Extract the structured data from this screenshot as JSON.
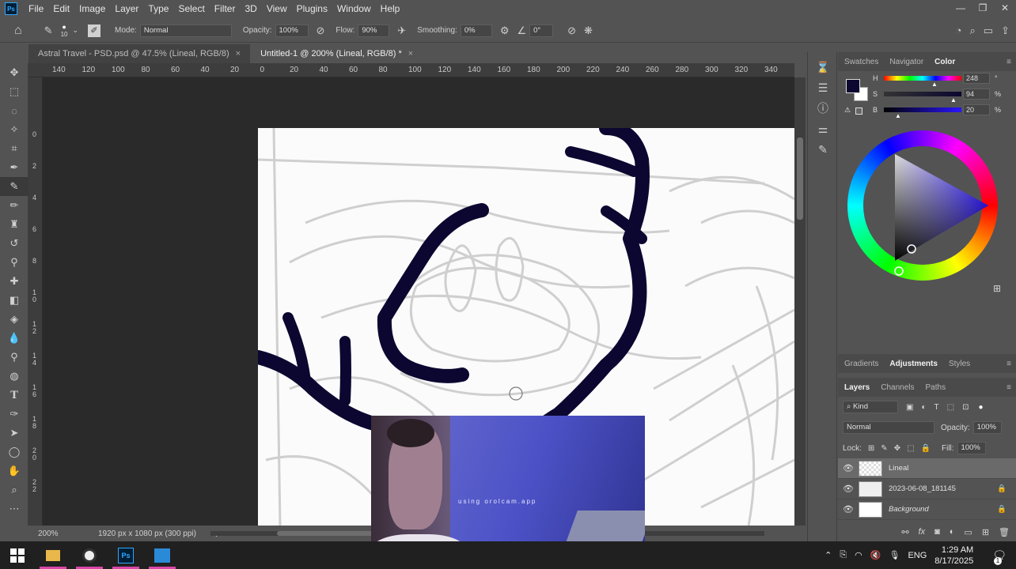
{
  "app": {
    "logo": "Ps",
    "menu": [
      "File",
      "Edit",
      "Image",
      "Layer",
      "Type",
      "Select",
      "Filter",
      "3D",
      "View",
      "Plugins",
      "Window",
      "Help"
    ],
    "window_controls": [
      "—",
      "❐",
      "✕"
    ]
  },
  "options_bar": {
    "brush_size": "10",
    "mode_label": "Mode:",
    "mode_value": "Normal",
    "opacity_label": "Opacity:",
    "opacity_value": "100%",
    "flow_label": "Flow:",
    "flow_value": "90%",
    "smoothing_label": "Smoothing:",
    "smoothing_value": "0%",
    "angle_value": "0°"
  },
  "tabs": [
    {
      "label": "Astral Travel - PSD.psd @ 47.5% (Lineal, RGB/8)",
      "close": "×"
    },
    {
      "label": "Untitled-1 @ 200% (Lineal, RGB/8) *",
      "close": "×"
    }
  ],
  "ruler": {
    "top": [
      "140",
      "120",
      "100",
      "80",
      "60",
      "40",
      "20",
      "0",
      "20",
      "40",
      "60",
      "80",
      "100",
      "120",
      "140",
      "160",
      "180",
      "200",
      "220",
      "240",
      "260",
      "280",
      "300",
      "320",
      "340"
    ],
    "left": [
      "0",
      "2",
      "4",
      "6",
      "8",
      "10",
      "12",
      "14",
      "16",
      "18",
      "20",
      "22"
    ]
  },
  "status": {
    "zoom": "200%",
    "doc_size": "1920 px x 1080 px (300 ppi)",
    "arrow": "›"
  },
  "color_panel": {
    "tabs": [
      "Swatches",
      "Navigator",
      "Color"
    ],
    "active_tab": "Color",
    "h_label": "H",
    "h_value": "248",
    "h_unit": "°",
    "s_label": "S",
    "s_value": "94",
    "s_unit": "%",
    "b_label": "B",
    "b_value": "20",
    "b_unit": "%",
    "foreground": "#0b0730",
    "background": "#ffffff"
  },
  "adjustments_panel": {
    "tabs": [
      "Gradients",
      "Adjustments",
      "Styles"
    ],
    "active_tab": "Adjustments"
  },
  "layers_panel": {
    "tabs": [
      "Layers",
      "Channels",
      "Paths"
    ],
    "active_tab": "Layers",
    "filter_label": "Kind",
    "blend_mode": "Normal",
    "opacity_label": "Opacity:",
    "opacity_value": "100%",
    "lock_label": "Lock:",
    "fill_label": "Fill:",
    "fill_value": "100%",
    "layers": [
      {
        "name": "Lineal",
        "selected": true,
        "locked": false
      },
      {
        "name": "2023-06-08_181145",
        "selected": false,
        "locked": true
      },
      {
        "name": "Background",
        "selected": false,
        "locked": true
      }
    ]
  },
  "webcam": {
    "watermark": "using orolcam.app"
  },
  "taskbar": {
    "language": "ENG",
    "time": "1:29 AM",
    "date": "8/17/2025",
    "notification_count": "1"
  }
}
